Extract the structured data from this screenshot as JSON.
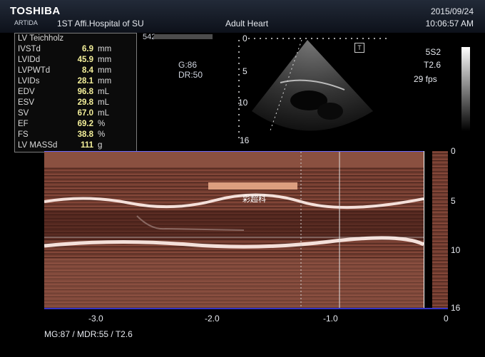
{
  "header": {
    "brand": "TOSHIBA",
    "brand_sub": "ARTIDA",
    "hospital": "1ST Affi.Hospital of SU",
    "exam": "Adult Heart",
    "date": "2015/09/24",
    "time": "10:06:57 AM"
  },
  "measurements": {
    "title": "LV Teichholz",
    "rows": [
      {
        "label": "IVSTd",
        "value": "6.9",
        "unit": "mm"
      },
      {
        "label": "LVIDd",
        "value": "45.9",
        "unit": "mm"
      },
      {
        "label": "LVPWTd",
        "value": "8.4",
        "unit": "mm"
      },
      {
        "label": "LVIDs",
        "value": "28.1",
        "unit": "mm"
      },
      {
        "label": "EDV",
        "value": "96.8",
        "unit": "mL"
      },
      {
        "label": "ESV",
        "value": "29.8",
        "unit": "mL"
      },
      {
        "label": "SV",
        "value": "67.0",
        "unit": "mL"
      },
      {
        "label": "EF",
        "value": "69.2",
        "unit": "%"
      },
      {
        "label": "FS",
        "value": "38.8",
        "unit": "%"
      },
      {
        "label": "LV MASSd",
        "value": "111",
        "unit": "g"
      }
    ]
  },
  "settings": {
    "depth_num": "542",
    "gain": "G:86",
    "dr": "DR:50",
    "probe": "5S2",
    "tis": "T2.6",
    "fps": "29 fps"
  },
  "sector_scale": [
    "0",
    "5",
    "10",
    "16"
  ],
  "mmode_scale": [
    "0",
    "5",
    "10",
    "16"
  ],
  "time_axis": [
    "-3.0",
    "-2.0",
    "-1.0",
    "0"
  ],
  "footer": {
    "mg": "MG:87",
    "mdr": "/ MDR:55",
    "tis": "/ T2.6"
  },
  "overlay_text": "彩超科"
}
